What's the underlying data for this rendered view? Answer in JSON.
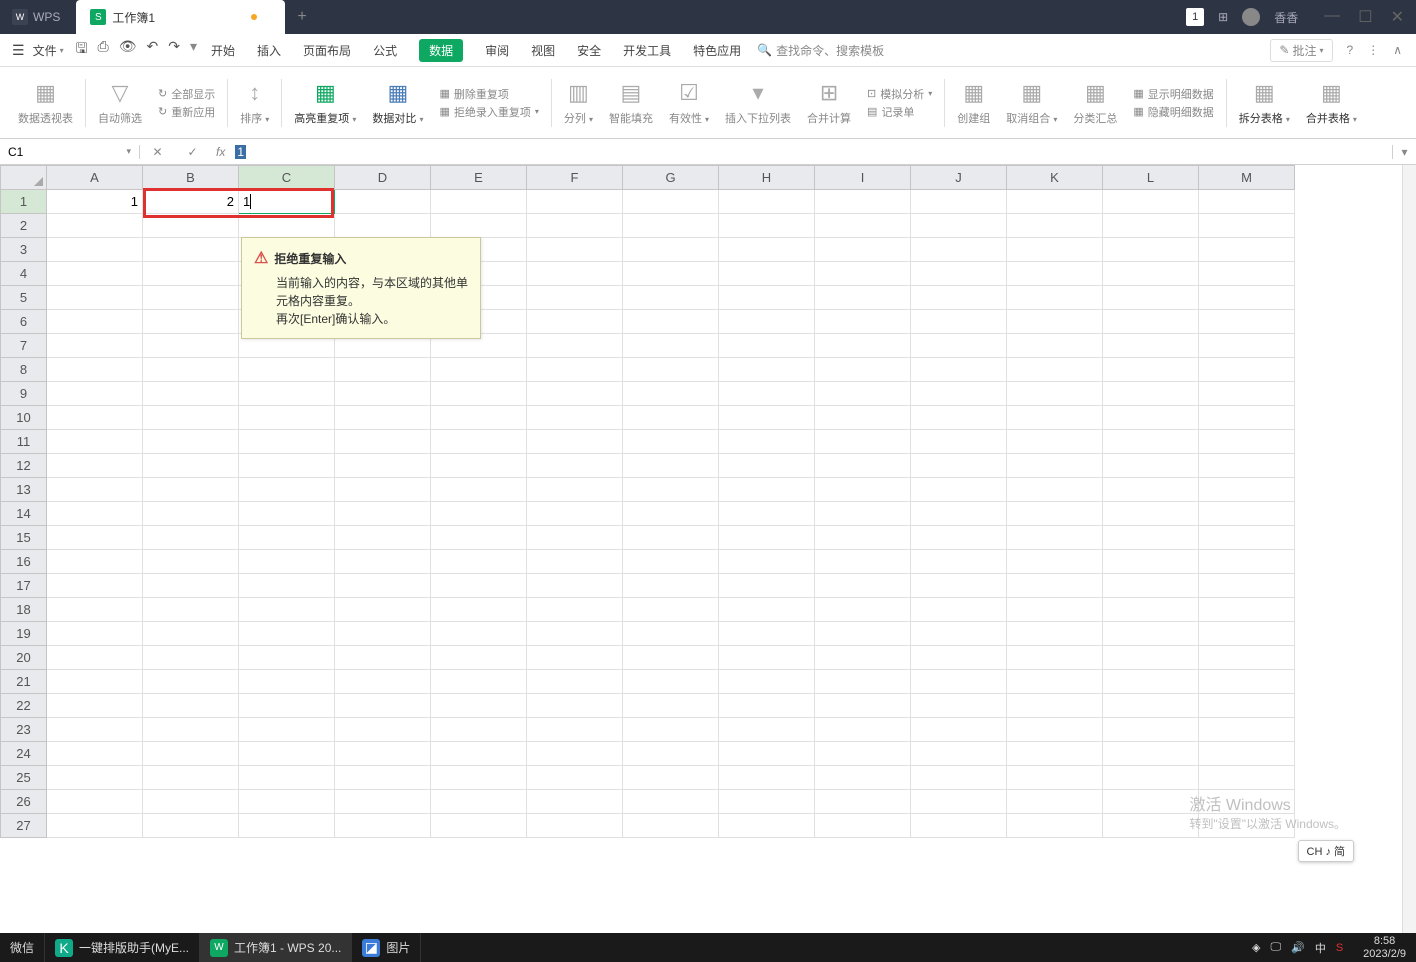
{
  "titlebar": {
    "app_name": "WPS",
    "tab_title": "工作簿1",
    "user_name": "香香",
    "badge_count": "1"
  },
  "menubar": {
    "file": "文件",
    "menus": [
      "开始",
      "插入",
      "页面布局",
      "公式",
      "数据",
      "审阅",
      "视图",
      "安全",
      "开发工具",
      "特色应用"
    ],
    "active_index": 4,
    "search_placeholder": "查找命令、搜索模板",
    "pizhu": "批注"
  },
  "ribbon": {
    "pivot": "数据透视表",
    "autofilter": "自动筛选",
    "show_all": "全部显示",
    "reapply": "重新应用",
    "sort": "排序",
    "highlight_dup": "高亮重复项",
    "data_compare": "数据对比",
    "remove_dup": "删除重复项",
    "reject_dup": "拒绝录入重复项",
    "split_col": "分列",
    "smart_fill": "智能填充",
    "validation": "有效性",
    "insert_dropdown": "插入下拉列表",
    "consolidate": "合并计算",
    "simulate": "模拟分析",
    "record_sheet": "记录单",
    "create_group": "创建组",
    "ungroup": "取消组合",
    "subtotal": "分类汇总",
    "show_detail": "显示明细数据",
    "hide_detail": "隐藏明细数据",
    "split_table": "拆分表格",
    "merge_table": "合并表格"
  },
  "formula_bar": {
    "name_box": "C1",
    "formula_value": "1"
  },
  "columns": [
    "A",
    "B",
    "C",
    "D",
    "E",
    "F",
    "G",
    "H",
    "I",
    "J",
    "K",
    "L",
    "M"
  ],
  "cells": {
    "A1": "1",
    "B1": "2",
    "C1": "1"
  },
  "active_cell": "C1",
  "tooltip": {
    "title": "拒绝重复输入",
    "line1": "当前输入的内容，与本区域的其他单元格内容重复。",
    "line2": "再次[Enter]确认输入。"
  },
  "watermark": {
    "title": "激活 Windows",
    "sub": "转到\"设置\"以激活 Windows。"
  },
  "ime": "CH ♪ 简",
  "taskbar": {
    "items": [
      {
        "label": "微信",
        "icon": ""
      },
      {
        "label": "一键排版助手(MyE...",
        "icon": "K"
      },
      {
        "label": "工作簿1 - WPS 20...",
        "icon": "W",
        "active": true
      },
      {
        "label": "图片",
        "icon": "◪"
      }
    ],
    "tray_lang": "中",
    "time": "8:58",
    "date": "2023/2/9"
  }
}
